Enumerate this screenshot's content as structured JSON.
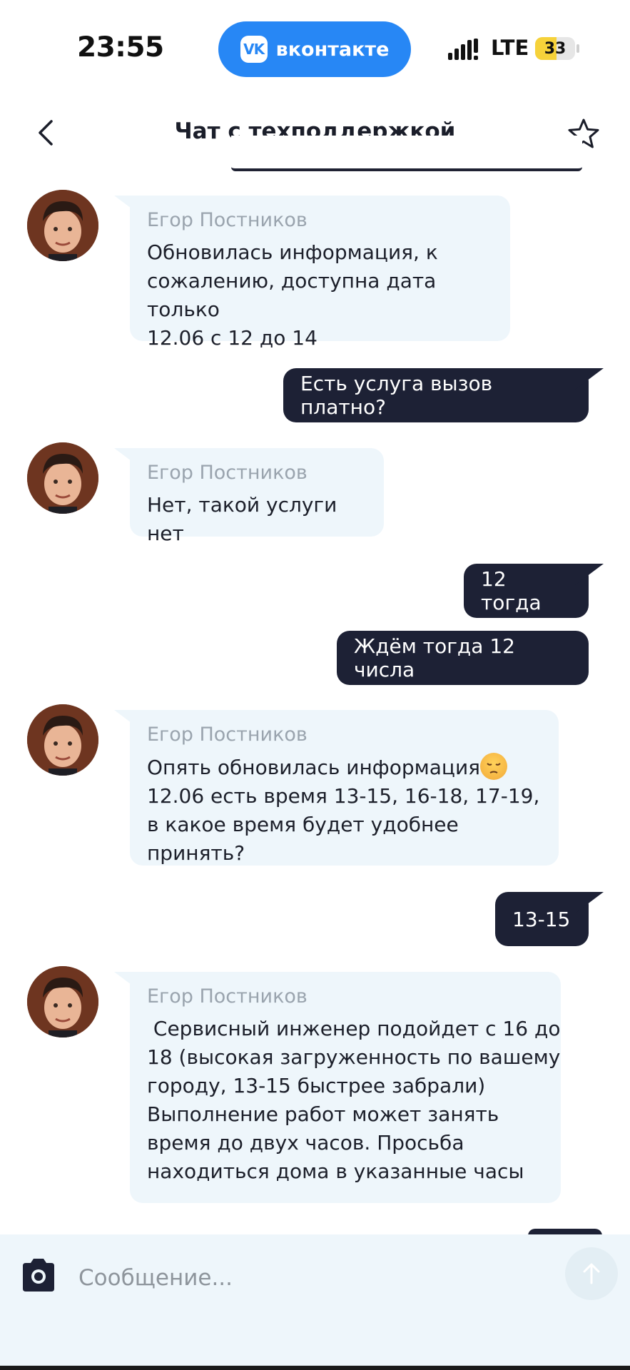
{
  "status_bar": {
    "time": "23:55",
    "vk_label": "вконтакте",
    "vk_logo_text": "VK",
    "network": "LTE",
    "battery": "33",
    "battery_level": 0.33,
    "battery_color": "#f6d23a"
  },
  "header": {
    "title": "Чат с техподдержкой",
    "back_icon": "chevron-left-icon",
    "favorite_icon": "star-icon"
  },
  "messages": [
    {
      "direction": "in",
      "sender": "Егор Постников",
      "text": "Обновилась информация, к\nсожалению, доступна дата только\n12.06 с 12 до 14"
    },
    {
      "direction": "out",
      "text": "Есть услуга вызов платно?"
    },
    {
      "direction": "in",
      "sender": "Егор Постников",
      "text": "Нет, такой услуги нет"
    },
    {
      "direction": "out",
      "text": "12 тогда"
    },
    {
      "direction": "out",
      "text": "Ждём тогда 12 числа"
    },
    {
      "direction": "in",
      "sender": "Егор Постников",
      "text_line1": "Опять обновилась информация",
      "emoji": "pensive-face",
      "text_rest": "12.06 есть время 13-15, 16-18, 17-19,\nв какое время будет удобнее принять?"
    },
    {
      "direction": "out",
      "text": "13-15"
    },
    {
      "direction": "in",
      "sender": "Егор Постников",
      "text": " Сервисный инженер подойдет с 16 до\n18 (высокая загруженность по вашему\nгороду, 13-15 быстрее забрали)\nВыполнение работ может занять\nвремя до двух часов. Просьба\nнаходиться дома в указанные часы"
    }
  ],
  "composer": {
    "placeholder": "Сообщение...",
    "camera_icon": "camera-icon",
    "send_icon": "send-arrow-icon"
  },
  "colors": {
    "accent": "#2787f5",
    "incoming_bubble": "#eef6fb",
    "outgoing_bubble": "#1d2135",
    "sender_name": "#9aa4ae"
  }
}
